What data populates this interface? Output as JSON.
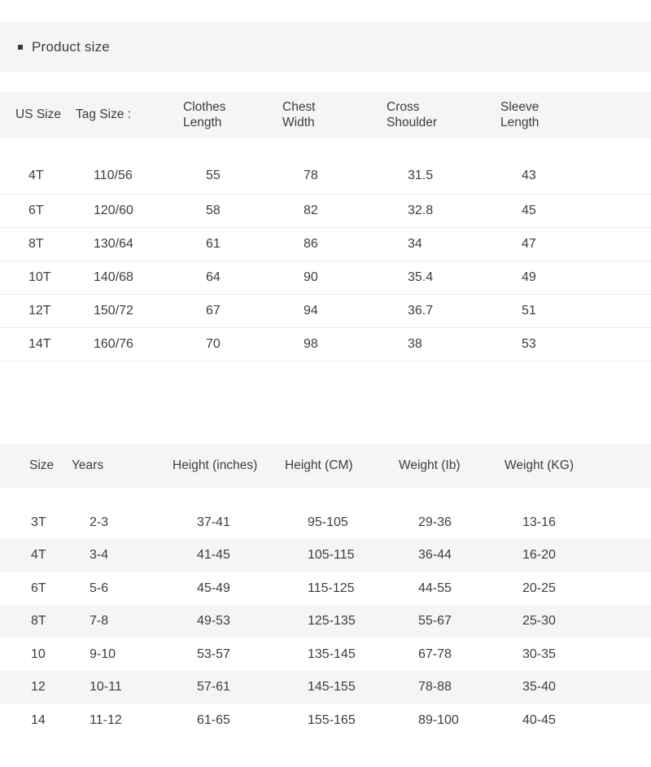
{
  "section": {
    "title": "Product size",
    "bullet_icon": "square-bullet-icon",
    "band_color": "#f5f5f5"
  },
  "colors": {
    "band": "#f5f5f5",
    "stripe": "#f5f5f5",
    "row_border": "#ededed",
    "text": "#3d3d3d",
    "page_background": "#ffffff"
  },
  "garment_table": {
    "name": "garment-measurements-table",
    "headers": [
      "US Size",
      "Tag Size :",
      "Clothes\nLength",
      "Chest\nWidth",
      "Cross\nShoulder",
      "Sleeve\nLength"
    ],
    "rows": [
      [
        "4T",
        "110/56",
        "55",
        "78",
        "31.5",
        "43"
      ],
      [
        "6T",
        "120/60",
        "58",
        "82",
        "32.8",
        "45"
      ],
      [
        "8T",
        "130/64",
        "61",
        "86",
        "34",
        "47"
      ],
      [
        "10T",
        "140/68",
        "64",
        "90",
        "35.4",
        "49"
      ],
      [
        "12T",
        "150/72",
        "67",
        "94",
        "36.7",
        "51"
      ],
      [
        "14T",
        "160/76",
        "70",
        "98",
        "38",
        "53"
      ]
    ]
  },
  "body_table": {
    "name": "body-size-reference-table",
    "headers": [
      "Size",
      "Years",
      "Height (inches)",
      "Height (CM)",
      "Weight (Ib)",
      "Weight (KG)"
    ],
    "rows": [
      [
        "3T",
        "2-3",
        "37-41",
        "95-105",
        "29-36",
        "13-16"
      ],
      [
        "4T",
        "3-4",
        "41-45",
        "105-115",
        "36-44",
        "16-20"
      ],
      [
        "6T",
        "5-6",
        "45-49",
        "115-125",
        "44-55",
        "20-25"
      ],
      [
        "8T",
        "7-8",
        "49-53",
        "125-135",
        "55-67",
        "25-30"
      ],
      [
        "10",
        "9-10",
        "53-57",
        "135-145",
        "67-78",
        "30-35"
      ],
      [
        "12",
        "10-11",
        "57-61",
        "145-155",
        "78-88",
        "35-40"
      ],
      [
        "14",
        "11-12",
        "61-65",
        "155-165",
        "89-100",
        "40-45"
      ]
    ]
  }
}
